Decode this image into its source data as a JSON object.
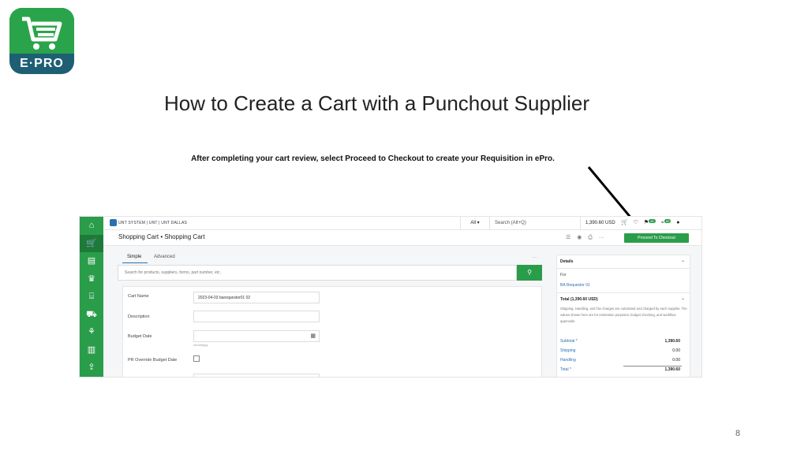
{
  "logo": {
    "text": "E·PRO"
  },
  "slide": {
    "title": "How to Create a Cart with a Punchout Supplier",
    "subtitle": "After completing your cart review, select Proceed to Checkout to create your Requisition in ePro.",
    "page_number": "8"
  },
  "app": {
    "brand": "UNT SYSTEM | UNT | UNT DALLAS",
    "scope": "All ▾",
    "search_placeholder": "Search (Alt+Q)",
    "cart_amount": "1,390.60 USD",
    "badges": [
      "40",
      "50"
    ],
    "breadcrumb": "Shopping Cart  •  Shopping Cart",
    "checkout_label": "Proceed To Checkout",
    "tabs": [
      {
        "label": "Simple"
      },
      {
        "label": "Advanced"
      }
    ],
    "tab_more": "...",
    "product_search_placeholder": "Search for products, suppliers, forms, part number, etc.",
    "form": {
      "cart_name_label": "Cart Name",
      "cart_name_value": "2023-04-03 barequestor01 02",
      "description_label": "Description",
      "budget_date_label": "Budget Date",
      "budget_date_hint": "mm/dd/yyyy",
      "override_label": "PR Override Budget Date"
    },
    "details": {
      "title": "Details",
      "for_label": "For",
      "for_value": "BA Requestor 01",
      "total_title": "Total (1,390.60 USD)",
      "note": "Shipping, Handling, and Tax charges are calculated and charged by each supplier. The values shown here are for estimation purposes, budget checking, and workflow approvals.",
      "subtotal_label": "Subtotal *",
      "subtotal_value": "1,390.60",
      "shipping_label": "Shipping",
      "shipping_value": "0.00",
      "handling_label": "Handling",
      "handling_value": "0.00",
      "total_label": "Total *",
      "total_value": "1,390.60"
    }
  }
}
